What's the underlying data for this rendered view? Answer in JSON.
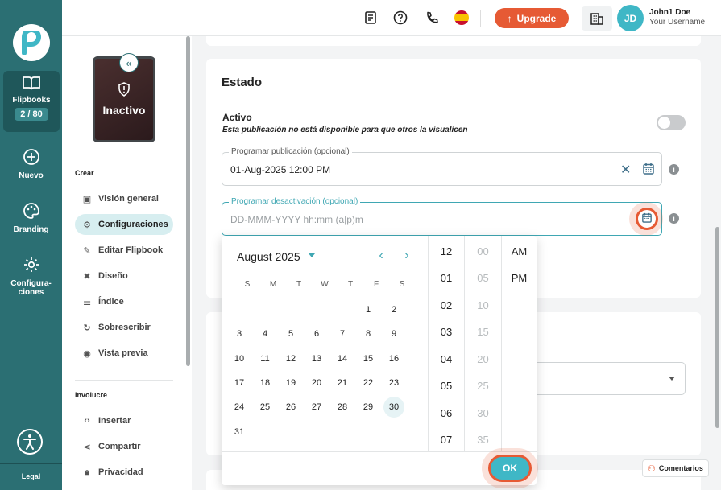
{
  "rail": {
    "flipbooks_label": "Flipbooks",
    "flipbooks_count": "2 / 80",
    "nuevo_label": "Nuevo",
    "branding_label": "Branding",
    "config_label_1": "Configura-",
    "config_label_2": "ciones",
    "legal_label": "Legal"
  },
  "topbar": {
    "upgrade_label": "Upgrade",
    "avatar_initials": "JD",
    "user_name": "John1 Doe",
    "user_sub": "Your Username"
  },
  "sidepanel": {
    "cover_status": "Inactivo",
    "section_create": "Crear",
    "section_involve": "Involucre",
    "items_create": [
      {
        "label": "Visión general",
        "icon": "overview-icon"
      },
      {
        "label": "Configuraciones",
        "icon": "gear-icon"
      },
      {
        "label": "Editar Flipbook",
        "icon": "pencil-icon"
      },
      {
        "label": "Diseño",
        "icon": "design-icon"
      },
      {
        "label": "Índice",
        "icon": "index-icon"
      },
      {
        "label": "Sobrescribir",
        "icon": "refresh-icon"
      },
      {
        "label": "Vista previa",
        "icon": "eye-icon"
      }
    ],
    "items_involve": [
      {
        "label": "Insertar",
        "icon": "code-icon"
      },
      {
        "label": "Compartir",
        "icon": "share-icon"
      },
      {
        "label": "Privacidad",
        "icon": "lock-icon"
      }
    ]
  },
  "estado": {
    "title": "Estado",
    "activo_label": "Activo",
    "activo_sub": "Esta publicación no está disponible para que otros la visualicen",
    "programar_pub_label": "Programar publicación (opcional)",
    "programar_pub_value": "01-Aug-2025 12:00 PM",
    "programar_des_label": "Programar desactivación (opcional)",
    "programar_des_placeholder": "DD-MMM-YYYY hh:mm (a|p)m"
  },
  "picker": {
    "month_label": "August 2025",
    "weekdays": [
      "S",
      "M",
      "T",
      "W",
      "T",
      "F",
      "S"
    ],
    "weeks": [
      [
        "",
        "",
        "",
        "",
        "",
        "1",
        "2"
      ],
      [
        "3",
        "4",
        "5",
        "6",
        "7",
        "8",
        "9"
      ],
      [
        "10",
        "11",
        "12",
        "13",
        "14",
        "15",
        "16"
      ],
      [
        "17",
        "18",
        "19",
        "20",
        "21",
        "22",
        "23"
      ],
      [
        "24",
        "25",
        "26",
        "27",
        "28",
        "29",
        "30"
      ],
      [
        "31",
        "",
        "",
        "",
        "",
        "",
        ""
      ]
    ],
    "selected_day": "30",
    "hours": [
      "12",
      "01",
      "02",
      "03",
      "04",
      "05",
      "06",
      "07"
    ],
    "minutes": [
      "00",
      "05",
      "10",
      "15",
      "20",
      "25",
      "30",
      "35"
    ],
    "ampm": [
      "AM",
      "PM"
    ],
    "ok_label": "OK"
  },
  "comments_label": "Comentarios",
  "colors": {
    "rail": "#2b6f73",
    "accent": "#3fb7c6",
    "upgrade": "#e65a34"
  }
}
